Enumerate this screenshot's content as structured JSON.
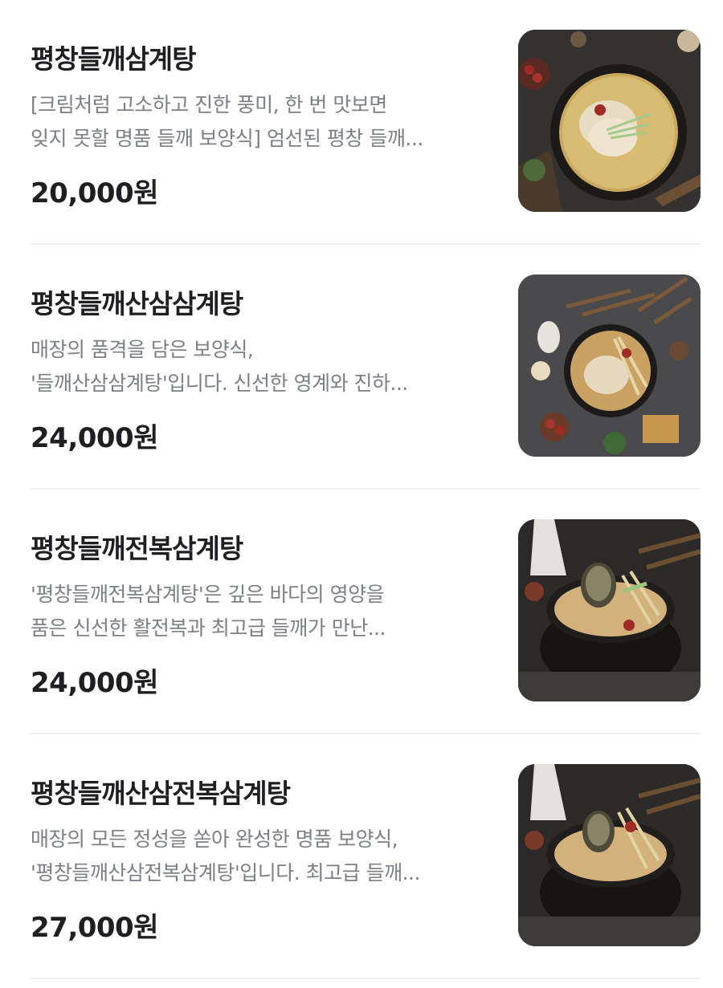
{
  "menu": {
    "items": [
      {
        "title": "평창들깨삼계탕",
        "desc_line1": "[크림처럼 고소하고 진한 풍미, 한 번 맛보면",
        "desc_line2": "잊지 못할 명품 들깨 보양식] 엄선된 평창 들깨...",
        "price": "20,000원",
        "photo": "perilla-samgyetang-photo"
      },
      {
        "title": "평창들깨산삼삼계탕",
        "desc_line1": "매장의 품격을 담은 보양식,",
        "desc_line2": "'들깨산삼삼계탕'입니다. 신선한 영계와 진하...",
        "price": "24,000원",
        "photo": "perilla-wild-ginseng-samgyetang-photo"
      },
      {
        "title": "평창들깨전복삼계탕",
        "desc_line1": "'평창들깨전복삼계탕'은 깊은 바다의 영양을",
        "desc_line2": "품은 신선한 활전복과 최고급 들깨가 만난...",
        "price": "24,000원",
        "photo": "perilla-abalone-samgyetang-photo"
      },
      {
        "title": "평창들깨산삼전복삼계탕",
        "desc_line1": "매장의 모든 정성을 쏟아 완성한 명품 보양식,",
        "desc_line2": "'평창들깨산삼전복삼계탕'입니다. 최고급 들깨...",
        "price": "27,000원",
        "photo": "perilla-ginseng-abalone-samgyetang-photo"
      }
    ]
  }
}
